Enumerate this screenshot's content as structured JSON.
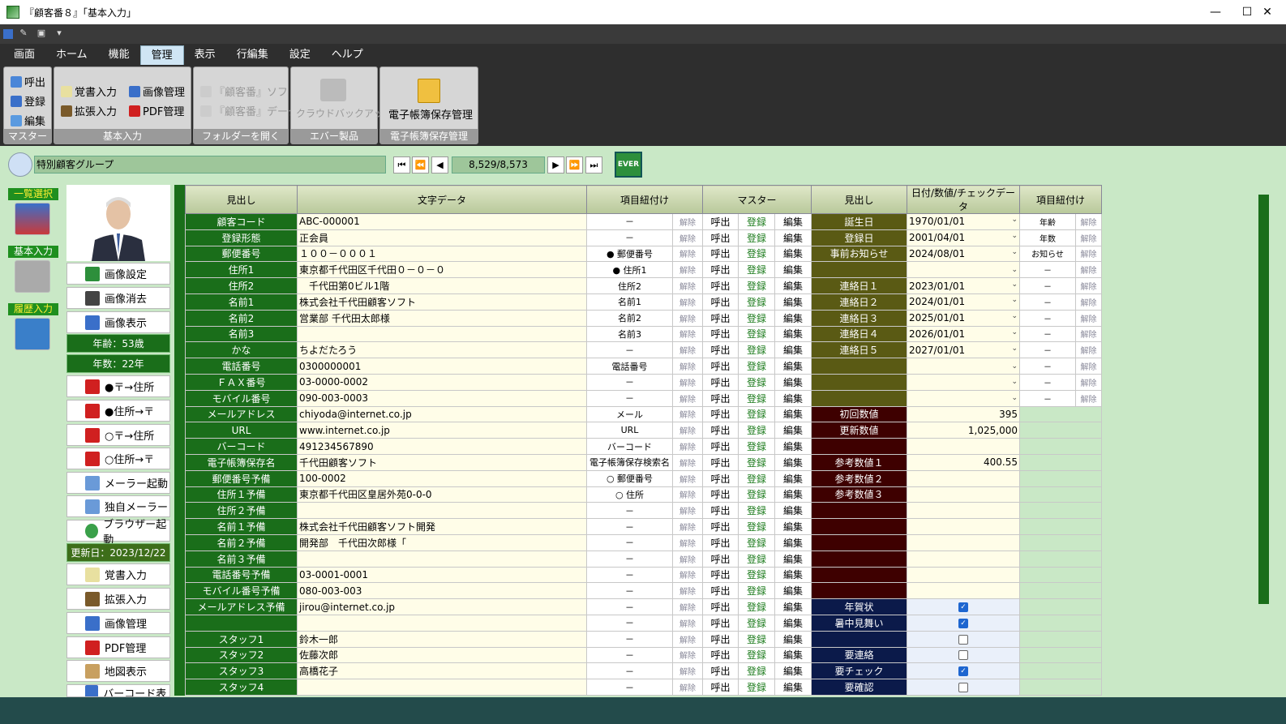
{
  "window": {
    "title": "『顧客番８』「基本入力」"
  },
  "menu": {
    "tabs": [
      "画面",
      "ホーム",
      "機能",
      "管理",
      "表示",
      "行編集",
      "設定",
      "ヘルプ"
    ],
    "active": "管理"
  },
  "ribbon": {
    "master": {
      "label": "マスター",
      "buttons": [
        "呼出",
        "登録",
        "編集"
      ]
    },
    "basic": {
      "label": "基本入力",
      "buttons": [
        "覚書入力",
        "拡張入力",
        "画像管理",
        "PDF管理"
      ]
    },
    "folder": {
      "label": "フォルダーを開く",
      "buttons": [
        "『顧客番』ソフト",
        "『顧客番』データ"
      ]
    },
    "ever": {
      "label": "エバー製品",
      "buttons": [
        "クラウドバックアップ"
      ]
    },
    "ebook": {
      "label": "電子帳簿保存管理",
      "buttons": [
        "電子帳簿保存管理"
      ]
    }
  },
  "nav": {
    "group": "特別顧客グループ",
    "position": "8,529/8,573",
    "ever_label": "EVER"
  },
  "leftnav": {
    "items": [
      "一覧選択",
      "基本入力",
      "履歴入力"
    ]
  },
  "side": {
    "buttons_top": [
      "画像設定",
      "画像消去",
      "画像表示"
    ],
    "age": "年齢：53歳",
    "years": "年数：22年",
    "buttons_mid": [
      "●〒→住所",
      "●住所→〒",
      "○〒→住所",
      "○住所→〒",
      "メーラー起動",
      "独自メーラー",
      "ブラウザー起動"
    ],
    "updated": "更新日：2023/12/22",
    "buttons_bottom": [
      "覚書入力",
      "拡張入力",
      "画像管理",
      "PDF管理",
      "地図表示",
      "バーコード表示"
    ]
  },
  "table": {
    "headers": [
      "見出し",
      "文字データ",
      "項目紐付け",
      "マスター",
      "見出し",
      "日付/数値/チェックデータ",
      "項目紐付け"
    ],
    "unlink": "解除",
    "master_buttons": [
      "呼出",
      "登録",
      "編集"
    ],
    "left_rows": [
      {
        "label": "顧客コード",
        "value": "ABC-000001",
        "link": "－"
      },
      {
        "label": "登録形態",
        "value": "正会員",
        "link": "－"
      },
      {
        "label": "郵便番号",
        "value": "１００－０００１",
        "link": "● 郵便番号"
      },
      {
        "label": "住所1",
        "value": "東京都千代田区千代田０－０－０",
        "link": "● 住所1"
      },
      {
        "label": "住所2",
        "value": "　千代田第0ビル1階",
        "link": "住所2"
      },
      {
        "label": "名前1",
        "value": "株式会社千代田顧客ソフト",
        "link": "名前1"
      },
      {
        "label": "名前2",
        "value": "営業部 千代田太郎様",
        "link": "名前2"
      },
      {
        "label": "名前3",
        "value": "",
        "link": "名前3"
      },
      {
        "label": "かな",
        "value": "ちよだたろう",
        "link": "－"
      },
      {
        "label": "電話番号",
        "value": "0300000001",
        "link": "電話番号"
      },
      {
        "label": "ＦＡＸ番号",
        "value": "03-0000-0002",
        "link": "－"
      },
      {
        "label": "モバイル番号",
        "value": "090-003-0003",
        "link": "－"
      },
      {
        "label": "メールアドレス",
        "value": "chiyoda@internet.co.jp",
        "link": "メール"
      },
      {
        "label": "URL",
        "value": "www.internet.co.jp",
        "link": "URL"
      },
      {
        "label": "バーコード",
        "value": "491234567890",
        "link": "バーコード"
      },
      {
        "label": "電子帳簿保存名",
        "value": "千代田顧客ソフト",
        "link": "電子帳簿保存検索名"
      },
      {
        "label": "郵便番号予備",
        "value": "100-0002",
        "link": "○ 郵便番号"
      },
      {
        "label": "住所１予備",
        "value": "東京都千代田区皇居外苑0-0-0",
        "link": "○ 住所"
      },
      {
        "label": "住所２予備",
        "value": "",
        "link": "－"
      },
      {
        "label": "名前１予備",
        "value": "株式会社千代田顧客ソフト開発",
        "link": "－"
      },
      {
        "label": "名前２予備",
        "value": "開発部　千代田次郎様「",
        "link": "－"
      },
      {
        "label": "名前３予備",
        "value": "",
        "link": "－"
      },
      {
        "label": "電話番号予備",
        "value": "03-0001-0001",
        "link": "－"
      },
      {
        "label": "モバイル番号予備",
        "value": "080-003-003",
        "link": "－"
      },
      {
        "label": "メールアドレス予備",
        "value": "jirou@internet.co.jp",
        "link": "－"
      },
      {
        "label": "",
        "value": "",
        "link": "－"
      },
      {
        "label": "スタッフ1",
        "value": "鈴木一郎",
        "link": "－"
      },
      {
        "label": "スタッフ2",
        "value": "佐藤次郎",
        "link": "－"
      },
      {
        "label": "スタッフ3",
        "value": "高橋花子",
        "link": "－"
      },
      {
        "label": "スタッフ4",
        "value": "",
        "link": "－"
      }
    ],
    "right_rows": [
      {
        "label": "誕生日",
        "value": "1970/01/01",
        "kind": "date",
        "color": "olive",
        "link": "年齢"
      },
      {
        "label": "登録日",
        "value": "2001/04/01",
        "kind": "date",
        "color": "olive",
        "link": "年数"
      },
      {
        "label": "事前お知らせ",
        "value": "2024/08/01",
        "kind": "date",
        "color": "olive",
        "link": "お知らせ"
      },
      {
        "label": "",
        "value": "",
        "kind": "date",
        "color": "olive",
        "link": "－"
      },
      {
        "label": "連絡日１",
        "value": "2023/01/01",
        "kind": "date",
        "color": "olive",
        "link": "－"
      },
      {
        "label": "連絡日２",
        "value": "2024/01/01",
        "kind": "date",
        "color": "olive",
        "link": "－"
      },
      {
        "label": "連絡日３",
        "value": "2025/01/01",
        "kind": "date",
        "color": "olive",
        "link": "－"
      },
      {
        "label": "連絡日４",
        "value": "2026/01/01",
        "kind": "date",
        "color": "olive",
        "link": "－"
      },
      {
        "label": "連絡日５",
        "value": "2027/01/01",
        "kind": "date",
        "color": "olive",
        "link": "－"
      },
      {
        "label": "",
        "value": "",
        "kind": "date",
        "color": "olive",
        "link": "－"
      },
      {
        "label": "",
        "value": "",
        "kind": "date",
        "color": "olive",
        "link": "－"
      },
      {
        "label": "",
        "value": "",
        "kind": "date",
        "color": "olive",
        "link": "－"
      },
      {
        "label": "初回数値",
        "value": "395",
        "kind": "num",
        "color": "maroon",
        "link": ""
      },
      {
        "label": "更新数値",
        "value": "1,025,000",
        "kind": "num",
        "color": "maroon",
        "link": ""
      },
      {
        "label": "",
        "value": "",
        "kind": "num",
        "color": "maroon",
        "link": ""
      },
      {
        "label": "参考数値１",
        "value": "400.55",
        "kind": "num",
        "color": "maroon",
        "link": ""
      },
      {
        "label": "参考数値２",
        "value": "",
        "kind": "num",
        "color": "maroon",
        "link": ""
      },
      {
        "label": "参考数値３",
        "value": "",
        "kind": "num",
        "color": "maroon",
        "link": ""
      },
      {
        "label": "",
        "value": "",
        "kind": "num",
        "color": "maroon",
        "link": ""
      },
      {
        "label": "",
        "value": "",
        "kind": "num",
        "color": "maroon",
        "link": ""
      },
      {
        "label": "",
        "value": "",
        "kind": "num",
        "color": "maroon",
        "link": ""
      },
      {
        "label": "",
        "value": "",
        "kind": "num",
        "color": "maroon",
        "link": ""
      },
      {
        "label": "",
        "value": "",
        "kind": "num",
        "color": "maroon",
        "link": ""
      },
      {
        "label": "",
        "value": "",
        "kind": "num",
        "color": "maroon",
        "link": ""
      },
      {
        "label": "年賀状",
        "checked": true,
        "kind": "chk",
        "color": "navy",
        "link": ""
      },
      {
        "label": "暑中見舞い",
        "checked": true,
        "kind": "chk",
        "color": "navy",
        "link": ""
      },
      {
        "label": "",
        "checked": false,
        "kind": "chk",
        "color": "navy",
        "link": ""
      },
      {
        "label": "要連絡",
        "checked": false,
        "kind": "chk",
        "color": "navy",
        "link": ""
      },
      {
        "label": "要チェック",
        "checked": true,
        "kind": "chk",
        "color": "navy",
        "link": ""
      },
      {
        "label": "要確認",
        "checked": false,
        "kind": "chk",
        "color": "navy",
        "link": ""
      }
    ]
  }
}
